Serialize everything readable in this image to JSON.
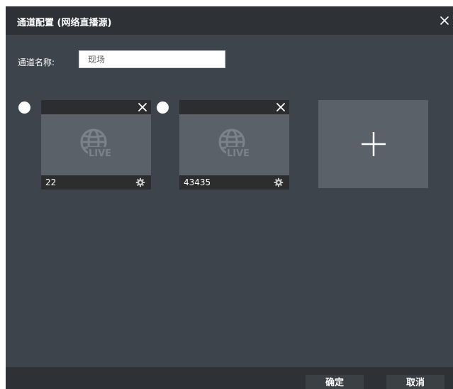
{
  "dialog": {
    "title": "通道配置 (网络直播源)",
    "close_icon": "close-icon"
  },
  "form": {
    "name_label": "通道名称:",
    "name_value": "现场"
  },
  "sources": [
    {
      "name": "22",
      "selected": false,
      "thumbnail_icon": "live-globe-icon",
      "thumbnail_text": "LIVE"
    },
    {
      "name": "43435",
      "selected": false,
      "thumbnail_icon": "live-globe-icon",
      "thumbnail_text": "LIVE"
    }
  ],
  "add_tile": {
    "icon": "plus-icon"
  },
  "footer": {
    "ok_label": "确定",
    "cancel_label": "取消"
  },
  "colors": {
    "dialog_bg": "#3d444c",
    "titlebar_bg": "#2e3236",
    "tile_bg": "#5a6168",
    "card_bar_bg": "#2b2d2f"
  }
}
